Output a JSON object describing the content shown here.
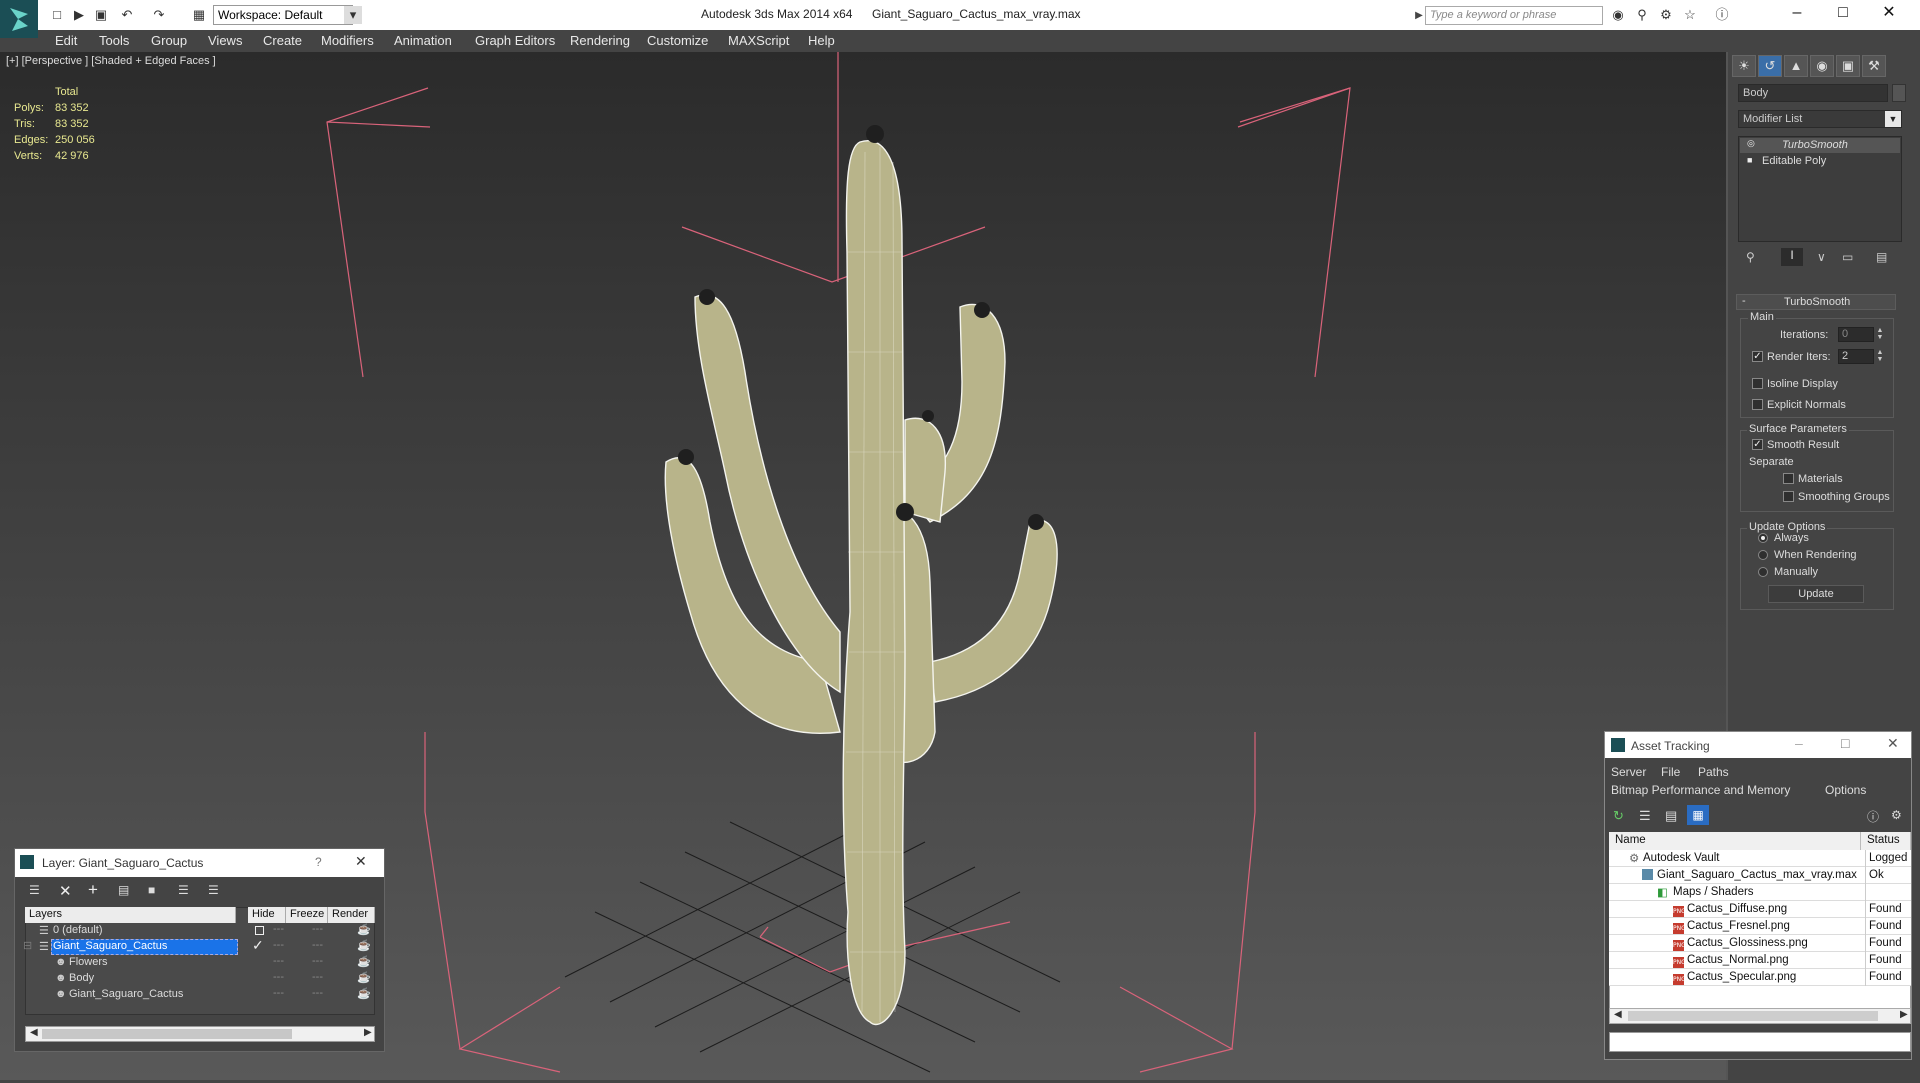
{
  "titlebar": {
    "app_title": "Autodesk 3ds Max  2014 x64",
    "file_title": "Giant_Saguaro_Cactus_max_vray.max",
    "workspace": "Workspace: Default",
    "search_placeholder": "Type a keyword or phrase"
  },
  "menu": [
    "Edit",
    "Tools",
    "Group",
    "Views",
    "Create",
    "Modifiers",
    "Animation",
    "Graph Editors",
    "Rendering",
    "Customize",
    "MAXScript",
    "Help"
  ],
  "viewport": {
    "label": "[+] [Perspective ] [Shaded + Edged Faces ]",
    "stats": {
      "header": "Total",
      "rows": [
        {
          "label": "Polys:",
          "value": "83 352"
        },
        {
          "label": "Tris:",
          "value": "83 352"
        },
        {
          "label": "Edges:",
          "value": "250 056"
        },
        {
          "label": "Verts:",
          "value": "42 976"
        }
      ]
    }
  },
  "command_panel": {
    "object_name": "Body",
    "modifier_list": "Modifier List",
    "stack": [
      "TurboSmooth",
      "Editable Poly"
    ],
    "rollout_title": "TurboSmooth",
    "main_group": "Main",
    "iterations_label": "Iterations:",
    "iterations_value": "0",
    "render_iters_label": "Render Iters:",
    "render_iters_value": "2",
    "isoline_label": "Isoline Display",
    "explicit_normals_label": "Explicit Normals",
    "surface_group": "Surface Parameters",
    "smooth_result_label": "Smooth Result",
    "separate_label": "Separate",
    "materials_label": "Materials",
    "smoothing_groups_label": "Smoothing Groups",
    "update_group": "Update Options",
    "always_label": "Always",
    "when_rendering_label": "When Rendering",
    "manually_label": "Manually",
    "update_button": "Update"
  },
  "layer_window": {
    "title": "Layer: Giant_Saguaro_Cactus",
    "help": "?",
    "columns": [
      "Layers",
      "Hide",
      "Freeze",
      "Render"
    ],
    "rows": [
      {
        "name": "0 (default)",
        "indent": 1
      },
      {
        "name": "Giant_Saguaro_Cactus",
        "indent": 1,
        "selected": true
      },
      {
        "name": "Flowers",
        "indent": 2
      },
      {
        "name": "Body",
        "indent": 2
      },
      {
        "name": "Giant_Saguaro_Cactus",
        "indent": 2
      }
    ]
  },
  "asset_tracking": {
    "title": "Asset Tracking",
    "menu1": [
      "Server",
      "File",
      "Paths"
    ],
    "menu2": [
      "Bitmap Performance and Memory",
      "Options"
    ],
    "columns": [
      "Name",
      "Status"
    ],
    "rows": [
      {
        "name": "Autodesk Vault",
        "status": "Logged",
        "indent": 1,
        "icon": "vault"
      },
      {
        "name": "Giant_Saguaro_Cactus_max_vray.max",
        "status": "Ok",
        "indent": 2,
        "icon": "maxfile"
      },
      {
        "name": "Maps / Shaders",
        "status": "",
        "indent": 3,
        "icon": "maps"
      },
      {
        "name": "Cactus_Diffuse.png",
        "status": "Found",
        "indent": 4,
        "icon": "png"
      },
      {
        "name": "Cactus_Fresnel.png",
        "status": "Found",
        "indent": 4,
        "icon": "png"
      },
      {
        "name": "Cactus_Glossiness.png",
        "status": "Found",
        "indent": 4,
        "icon": "png"
      },
      {
        "name": "Cactus_Normal.png",
        "status": "Found",
        "indent": 4,
        "icon": "png"
      },
      {
        "name": "Cactus_Specular.png",
        "status": "Found",
        "indent": 4,
        "icon": "png"
      }
    ]
  },
  "colors": {
    "viewport_top": "#2b2b2b",
    "viewport_bottom": "#595959",
    "stats_text": "#e8e890",
    "bounding_box": "#d9637a",
    "selection": "#1a73e8",
    "cactus_fill": "#b8b48a"
  }
}
